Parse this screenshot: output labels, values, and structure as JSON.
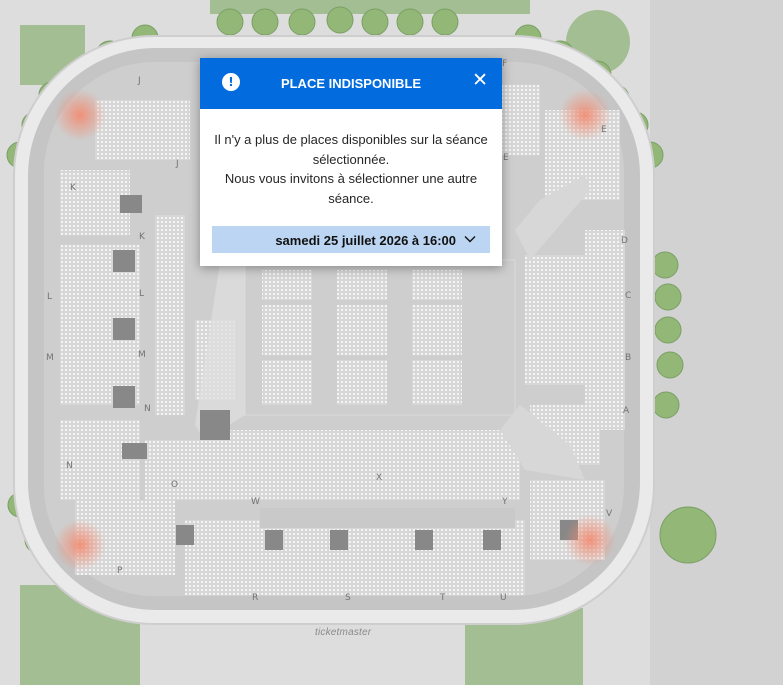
{
  "modal": {
    "title": "PLACE INDISPONIBLE",
    "info_glyph": "!",
    "close_glyph": "✕",
    "message_line1": "Il n'y a plus de places disponibles sur la séance sélectionnée.",
    "message_line2": "Nous vous invitons à sélectionner une autre séance.",
    "selected_date": "samedi 25 juillet 2026 à 16:00"
  },
  "brand": {
    "logo_text": "ticketmaster"
  },
  "map": {
    "section_labels": [
      "J",
      "J",
      "K",
      "K",
      "L",
      "L",
      "M",
      "M",
      "N",
      "N",
      "O",
      "P",
      "R",
      "S",
      "T",
      "U",
      "W",
      "X",
      "Y",
      "V",
      "A",
      "B",
      "C",
      "D",
      "E",
      "E",
      "F"
    ]
  },
  "colors": {
    "accent": "#026cdf",
    "select_bg": "#bcd5f2",
    "trees": "#7aa85a",
    "arena": "#b5b5b5"
  }
}
